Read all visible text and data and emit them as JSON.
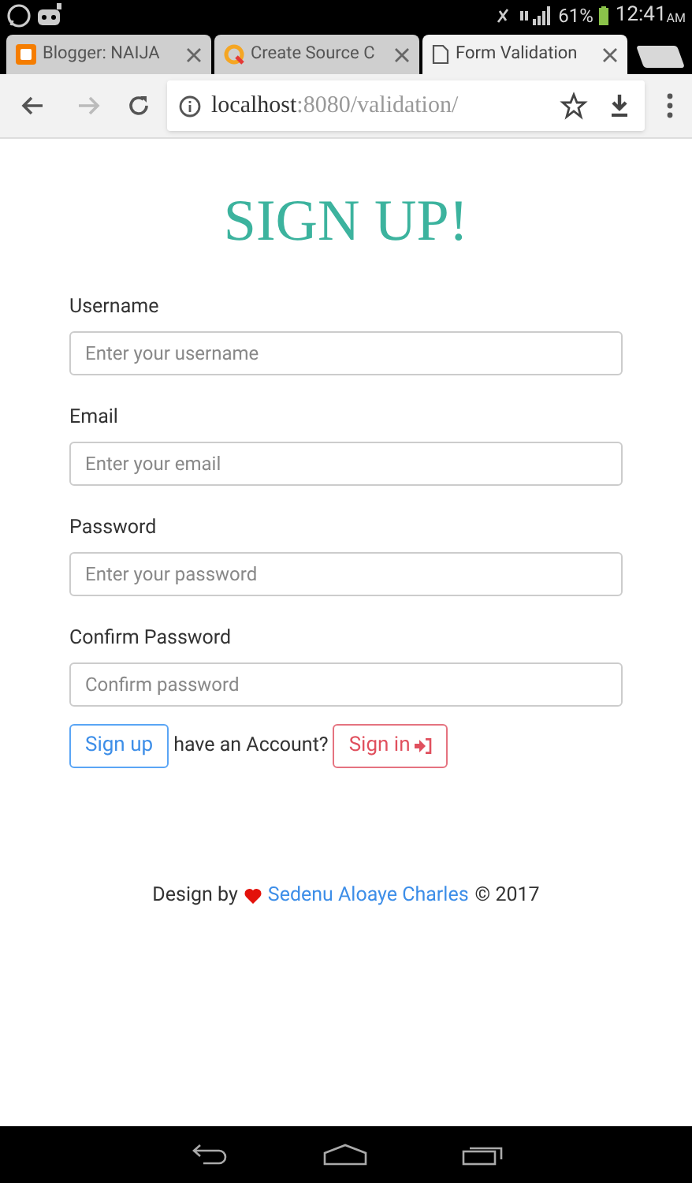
{
  "status_bar": {
    "battery": "61%",
    "time": "12:41",
    "meridiem": "AM"
  },
  "tabs": [
    {
      "title": "Blogger: NAIJA",
      "kind": "blogger",
      "selected": false
    },
    {
      "title": "Create Source C",
      "kind": "source",
      "selected": false
    },
    {
      "title": "Form Validation",
      "kind": "page",
      "selected": true
    }
  ],
  "address_bar": {
    "host": "localhost",
    "path": ":8080/validation/"
  },
  "form": {
    "title": "SIGN UP!",
    "fields": [
      {
        "label": "Username",
        "placeholder": "Enter your username"
      },
      {
        "label": "Email",
        "placeholder": "Enter your email"
      },
      {
        "label": "Password",
        "placeholder": "Enter your password"
      },
      {
        "label": "Confirm Password",
        "placeholder": "Confirm password"
      }
    ],
    "submit": "Sign up",
    "prompt": "have an Account?",
    "signin": "Sign in"
  },
  "footer": {
    "prefix": "Design by",
    "author": "Sedenu Aloaye Charles",
    "suffix": "© 2017"
  }
}
